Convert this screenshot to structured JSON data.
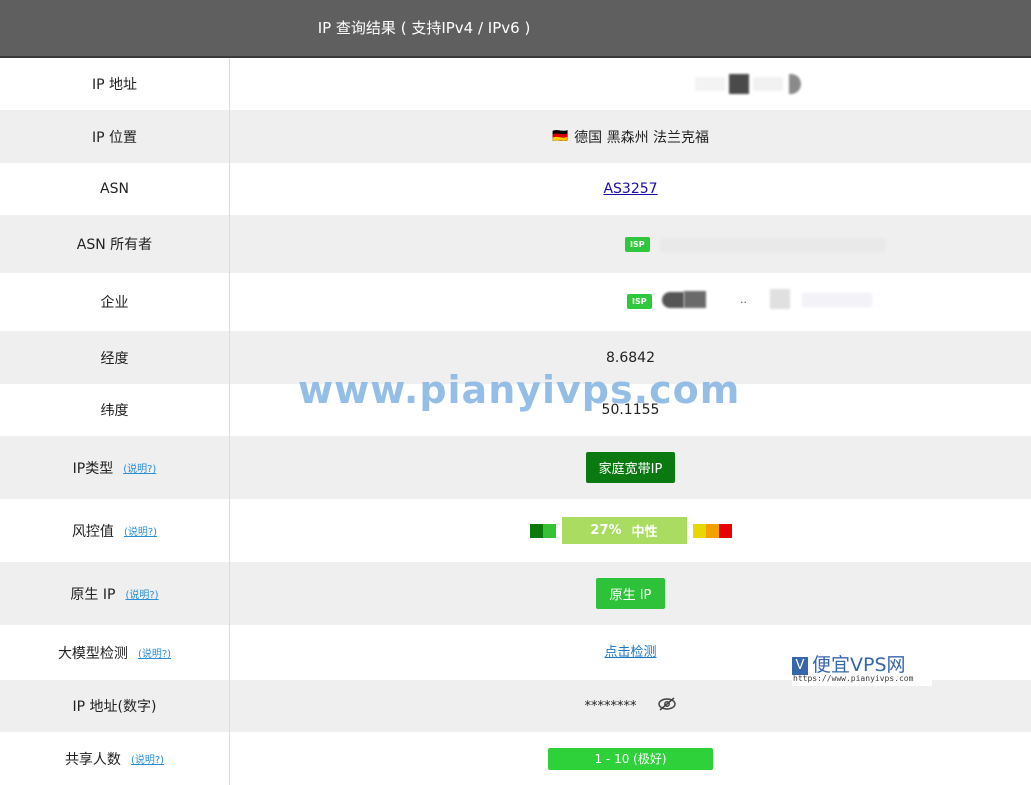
{
  "header": {
    "title": "IP 查询结果 ( 支持IPv4 / IPv6 )"
  },
  "rows": {
    "ip_address": {
      "label": "IP 地址"
    },
    "ip_location": {
      "label": "IP 位置",
      "flag": "🇩🇪",
      "value": "德国 黑森州 法兰克福"
    },
    "asn": {
      "label": "ASN",
      "value": "AS3257"
    },
    "asn_owner": {
      "label": "ASN 所有者",
      "badge": "ISP"
    },
    "enterprise": {
      "label": "企业",
      "badge": "ISP",
      "value": ".."
    },
    "longitude": {
      "label": "经度",
      "value": "8.6842"
    },
    "latitude": {
      "label": "纬度",
      "value": "50.1155"
    },
    "ip_type": {
      "label": "IP类型",
      "hint": "(说明?)",
      "value": "家庭宽带IP"
    },
    "risk": {
      "label": "风控值",
      "hint": "(说明?)",
      "percent": "27%",
      "level": "中性"
    },
    "native_ip": {
      "label": "原生 IP",
      "hint": "(说明?)",
      "value": "原生 IP"
    },
    "llm_check": {
      "label": "大模型检测",
      "hint": "(说明?)",
      "link": "点击检测"
    },
    "ip_numeric": {
      "label": "IP 地址(数字)",
      "value": "********"
    },
    "shared_users": {
      "label": "共享人数",
      "hint": "(说明?)",
      "value": "1 - 10 (极好)"
    }
  },
  "watermark": {
    "text": "www.pianyivps.com"
  },
  "logo": {
    "mark": "V",
    "name": "便宜VPS网",
    "url": "https://www.pianyivps.com"
  },
  "colors": {
    "header_bg": "#5f5f5f",
    "row_shade": "#efefef",
    "dark_green": "#0a7a10",
    "green": "#2ec23a",
    "risk_bar": "#a9dc60"
  }
}
